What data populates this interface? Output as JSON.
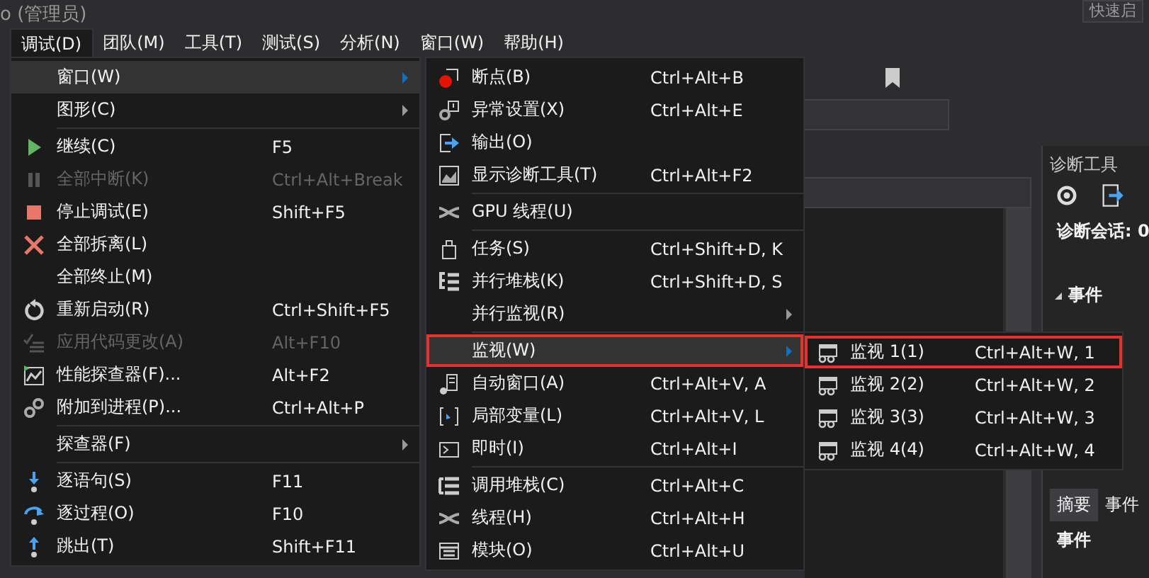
{
  "title_fragment": "o (管理员)",
  "quick_launch": "快速启",
  "menubar": [
    {
      "label": "调试(D)",
      "selected": true
    },
    {
      "label": "团队(M)",
      "selected": false
    },
    {
      "label": "工具(T)",
      "selected": false
    },
    {
      "label": "测试(S)",
      "selected": false
    },
    {
      "label": "分析(N)",
      "selected": false
    },
    {
      "label": "窗口(W)",
      "selected": false
    },
    {
      "label": "帮助(H)",
      "selected": false
    }
  ],
  "debug_menu": [
    {
      "kind": "item",
      "label": "窗口(W)",
      "submenu": true,
      "selected": true,
      "disabled": false,
      "annotated": false
    },
    {
      "kind": "item",
      "label": "图形(C)",
      "submenu": true,
      "selected": false,
      "disabled": false,
      "annotated": false
    },
    {
      "kind": "separator"
    },
    {
      "kind": "item",
      "label": "继续(C)",
      "shortcut": "F5",
      "submenu": false,
      "selected": false,
      "disabled": false,
      "annotated": false
    },
    {
      "kind": "item",
      "label": "全部中断(K)",
      "shortcut": "Ctrl+Alt+Break",
      "submenu": false,
      "selected": false,
      "disabled": true,
      "annotated": false
    },
    {
      "kind": "item",
      "label": "停止调试(E)",
      "shortcut": "Shift+F5",
      "submenu": false,
      "selected": false,
      "disabled": false,
      "annotated": false
    },
    {
      "kind": "item",
      "label": "全部拆离(L)",
      "submenu": false,
      "selected": false,
      "disabled": false,
      "annotated": false
    },
    {
      "kind": "item",
      "label": "全部终止(M)",
      "submenu": false,
      "selected": false,
      "disabled": false,
      "annotated": false
    },
    {
      "kind": "item",
      "label": "重新启动(R)",
      "shortcut": "Ctrl+Shift+F5",
      "submenu": false,
      "selected": false,
      "disabled": false,
      "annotated": false
    },
    {
      "kind": "item",
      "label": "应用代码更改(A)",
      "shortcut": "Alt+F10",
      "submenu": false,
      "selected": false,
      "disabled": true,
      "annotated": false
    },
    {
      "kind": "item",
      "label": "性能探查器(F)...",
      "shortcut": "Alt+F2",
      "submenu": false,
      "selected": false,
      "disabled": false,
      "annotated": false
    },
    {
      "kind": "item",
      "label": "附加到进程(P)...",
      "shortcut": "Ctrl+Alt+P",
      "submenu": false,
      "selected": false,
      "disabled": false,
      "annotated": false
    },
    {
      "kind": "separator"
    },
    {
      "kind": "item",
      "label": "探查器(F)",
      "submenu": true,
      "selected": false,
      "disabled": false,
      "annotated": false
    },
    {
      "kind": "separator"
    },
    {
      "kind": "item",
      "label": "逐语句(S)",
      "shortcut": "F11",
      "submenu": false,
      "selected": false,
      "disabled": false,
      "annotated": false
    },
    {
      "kind": "item",
      "label": "逐过程(O)",
      "shortcut": "F10",
      "submenu": false,
      "selected": false,
      "disabled": false,
      "annotated": false
    },
    {
      "kind": "item",
      "label": "跳出(T)",
      "shortcut": "Shift+F11",
      "submenu": false,
      "selected": false,
      "disabled": false,
      "annotated": false
    }
  ],
  "window_menu": [
    {
      "kind": "item",
      "label": "断点(B)",
      "shortcut": "Ctrl+Alt+B",
      "submenu": false,
      "selected": false,
      "disabled": false,
      "annotated": false
    },
    {
      "kind": "item",
      "label": "异常设置(X)",
      "shortcut": "Ctrl+Alt+E",
      "submenu": false,
      "selected": false,
      "disabled": false,
      "annotated": false
    },
    {
      "kind": "item",
      "label": "输出(O)",
      "submenu": false,
      "selected": false,
      "disabled": false,
      "annotated": false
    },
    {
      "kind": "item",
      "label": "显示诊断工具(T)",
      "shortcut": "Ctrl+Alt+F2",
      "submenu": false,
      "selected": false,
      "disabled": false,
      "annotated": false
    },
    {
      "kind": "separator"
    },
    {
      "kind": "item",
      "label": "GPU 线程(U)",
      "submenu": false,
      "selected": false,
      "disabled": false,
      "annotated": false
    },
    {
      "kind": "separator"
    },
    {
      "kind": "item",
      "label": "任务(S)",
      "shortcut": "Ctrl+Shift+D, K",
      "submenu": false,
      "selected": false,
      "disabled": false,
      "annotated": false
    },
    {
      "kind": "item",
      "label": "并行堆栈(K)",
      "shortcut": "Ctrl+Shift+D, S",
      "submenu": false,
      "selected": false,
      "disabled": false,
      "annotated": false
    },
    {
      "kind": "item",
      "label": "并行监视(R)",
      "submenu": true,
      "selected": false,
      "disabled": false,
      "annotated": false
    },
    {
      "kind": "separator"
    },
    {
      "kind": "item",
      "label": "监视(W)",
      "submenu": true,
      "selected": true,
      "disabled": false,
      "annotated": true
    },
    {
      "kind": "item",
      "label": "自动窗口(A)",
      "shortcut": "Ctrl+Alt+V, A",
      "submenu": false,
      "selected": false,
      "disabled": false,
      "annotated": false
    },
    {
      "kind": "item",
      "label": "局部变量(L)",
      "shortcut": "Ctrl+Alt+V, L",
      "submenu": false,
      "selected": false,
      "disabled": false,
      "annotated": false
    },
    {
      "kind": "item",
      "label": "即时(I)",
      "shortcut": "Ctrl+Alt+I",
      "submenu": false,
      "selected": false,
      "disabled": false,
      "annotated": false
    },
    {
      "kind": "separator"
    },
    {
      "kind": "item",
      "label": "调用堆栈(C)",
      "shortcut": "Ctrl+Alt+C",
      "submenu": false,
      "selected": false,
      "disabled": false,
      "annotated": false
    },
    {
      "kind": "item",
      "label": "线程(H)",
      "shortcut": "Ctrl+Alt+H",
      "submenu": false,
      "selected": false,
      "disabled": false,
      "annotated": false
    },
    {
      "kind": "item",
      "label": "模块(O)",
      "shortcut": "Ctrl+Alt+U",
      "submenu": false,
      "selected": false,
      "disabled": false,
      "annotated": false
    }
  ],
  "watch_menu": [
    {
      "kind": "item",
      "label": "监视 1(1)",
      "shortcut": "Ctrl+Alt+W, 1",
      "submenu": false,
      "selected": false,
      "disabled": false,
      "annotated": true
    },
    {
      "kind": "item",
      "label": "监视 2(2)",
      "shortcut": "Ctrl+Alt+W, 2",
      "submenu": false,
      "selected": false,
      "disabled": false,
      "annotated": false
    },
    {
      "kind": "item",
      "label": "监视 3(3)",
      "shortcut": "Ctrl+Alt+W, 3",
      "submenu": false,
      "selected": false,
      "disabled": false,
      "annotated": false
    },
    {
      "kind": "item",
      "label": "监视 4(4)",
      "shortcut": "Ctrl+Alt+W, 4",
      "submenu": false,
      "selected": false,
      "disabled": false,
      "annotated": false
    }
  ],
  "diagnostics_panel": {
    "title": "诊断工具",
    "session": "诊断会话: 0",
    "events_section": "事件",
    "tabs": [
      {
        "label": "摘要",
        "selected": true
      },
      {
        "label": "事件",
        "selected": false
      }
    ],
    "events_heading": "事件"
  }
}
